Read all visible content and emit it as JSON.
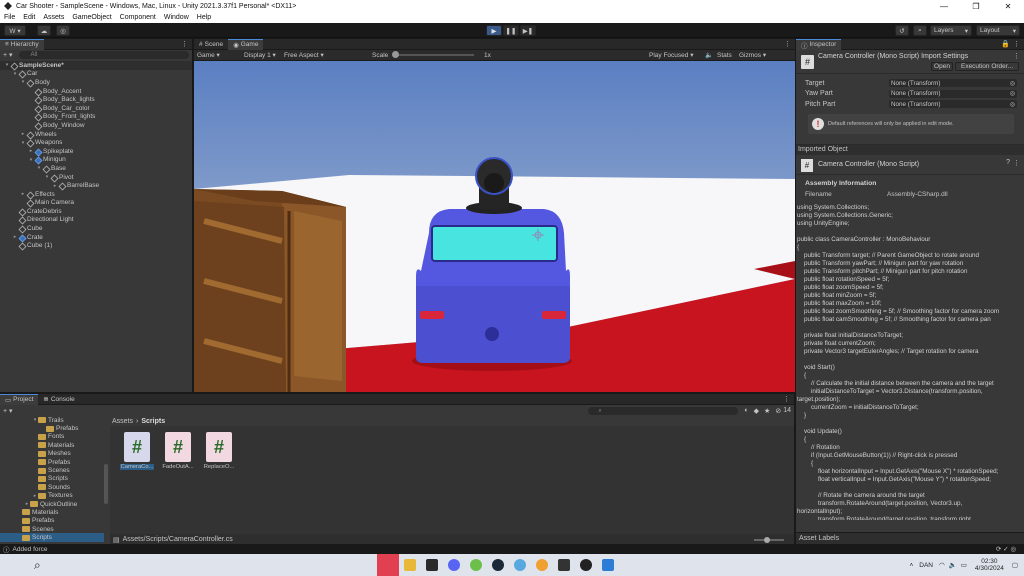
{
  "window": {
    "title": "Car Shooter - SampleScene - Windows, Mac, Linux - Unity 2021.3.37f1 Personal* <DX11>",
    "controls": [
      "—",
      "❐",
      "✕"
    ]
  },
  "menu": [
    "File",
    "Edit",
    "Assets",
    "GameObject",
    "Component",
    "Window",
    "Help"
  ],
  "toolbar": {
    "account": "W ▾",
    "layers": "Layers",
    "layout": "Layout"
  },
  "hierarchy": {
    "tab": "Hierarchy",
    "search_placeholder": "All",
    "items": [
      {
        "label": "SampleScene*",
        "depth": 0,
        "arrow": "▾",
        "type": "scene"
      },
      {
        "label": "Car",
        "depth": 1,
        "arrow": "▾",
        "type": "cube"
      },
      {
        "label": "Body",
        "depth": 2,
        "arrow": "▾",
        "type": "cube"
      },
      {
        "label": "Body_Accent",
        "depth": 3,
        "arrow": "",
        "type": "cube"
      },
      {
        "label": "Body_Back_lights",
        "depth": 3,
        "arrow": "",
        "type": "cube"
      },
      {
        "label": "Body_Car_color",
        "depth": 3,
        "arrow": "",
        "type": "cube"
      },
      {
        "label": "Body_Front_lights",
        "depth": 3,
        "arrow": "",
        "type": "cube"
      },
      {
        "label": "Body_Window",
        "depth": 3,
        "arrow": "",
        "type": "cube"
      },
      {
        "label": "Wheels",
        "depth": 2,
        "arrow": "▸",
        "type": "cube"
      },
      {
        "label": "Weapons",
        "depth": 2,
        "arrow": "▾",
        "type": "cube"
      },
      {
        "label": "Spikeplate",
        "depth": 3,
        "arrow": "▸",
        "type": "blue"
      },
      {
        "label": "Minigun",
        "depth": 3,
        "arrow": "▾",
        "type": "blue"
      },
      {
        "label": "Base",
        "depth": 4,
        "arrow": "▾",
        "type": "cube"
      },
      {
        "label": "Pivot",
        "depth": 5,
        "arrow": "▾",
        "type": "cube"
      },
      {
        "label": "BarrelBase",
        "depth": 6,
        "arrow": "▸",
        "type": "cube"
      },
      {
        "label": "Effects",
        "depth": 2,
        "arrow": "▸",
        "type": "cube"
      },
      {
        "label": "Main Camera",
        "depth": 2,
        "arrow": "",
        "type": "cube"
      },
      {
        "label": "CrateDebris",
        "depth": 1,
        "arrow": "",
        "type": "cube"
      },
      {
        "label": "Directional Light",
        "depth": 1,
        "arrow": "",
        "type": "cube"
      },
      {
        "label": "Cube",
        "depth": 1,
        "arrow": "",
        "type": "cube"
      },
      {
        "label": "Crate",
        "depth": 1,
        "arrow": "▸",
        "type": "blue"
      },
      {
        "label": "Cube (1)",
        "depth": 1,
        "arrow": "",
        "type": "cube"
      }
    ]
  },
  "game_view": {
    "tabs": [
      "Scene",
      "Game"
    ],
    "active_tab": "Game",
    "display_mode": "Game",
    "display": "Display 1",
    "aspect": "Free Aspect",
    "scale_label": "Scale",
    "scale_value": "1x",
    "play_mode": "Play Focused",
    "stats": "Stats",
    "gizmos": "Gizmos"
  },
  "inspector": {
    "tab": "Inspector",
    "component_title": "Camera Controller (Mono Script) Import Settings",
    "open_button": "Open",
    "execution_order_button": "Execution Order...",
    "fields": [
      {
        "label": "Target",
        "value": "None (Transform)"
      },
      {
        "label": "Yaw Part",
        "value": "None (Transform)"
      },
      {
        "label": "Pitch Part",
        "value": "None (Transform)"
      }
    ],
    "warning": "Default references will only be applied in edit mode.",
    "imported_object": "Imported Object",
    "script_title": "Camera Controller (Mono Script)",
    "assembly_info": "Assembly Information",
    "filename_label": "Filename",
    "filename_value": "Assembly-CSharp.dll",
    "asset_labels": "Asset Labels",
    "code": [
      "using System.Collections;",
      "using System.Collections.Generic;",
      "using UnityEngine;",
      "",
      "public class CameraController : MonoBehaviour",
      "{",
      "    public Transform target; // Parent GameObject to rotate around",
      "    public Transform yawPart; // Minigun part for yaw rotation",
      "    public Transform pitchPart; // Minigun part for pitch rotation",
      "    public float rotationSpeed = 5f;",
      "    public float zoomSpeed = 5f;",
      "    public float minZoom = 5f;",
      "    public float maxZoom = 10f;",
      "    public float zoomSmoothing = 5f; // Smoothing factor for camera zoom",
      "    public float camSmoothing = 5f; // Smoothing factor for camera pan",
      "",
      "    private float initialDistanceToTarget;",
      "    private float currentZoom;",
      "    private Vector3 targetEulerAngles; // Target rotation for camera",
      "",
      "    void Start()",
      "    {",
      "        // Calculate the initial distance between the camera and the target",
      "        initialDistanceToTarget = Vector3.Distance(transform.position,",
      "target.position);",
      "        currentZoom = initialDistanceToTarget;",
      "    }",
      "",
      "    void Update()",
      "    {",
      "        // Rotation",
      "        if (Input.GetMouseButton(1)) // Right-click is pressed",
      "        {",
      "            float horizontalInput = Input.GetAxis(\"Mouse X\") * rotationSpeed;",
      "            float verticalInput = Input.GetAxis(\"Mouse Y\") * rotationSpeed;",
      "",
      "            // Rotate the camera around the target",
      "            transform.RotateAround(target.position, Vector3.up,",
      "horizontalInput);",
      "            transform.RotateAround(target.position, transform.right,"
    ]
  },
  "project": {
    "tabs": [
      "Project",
      "Console"
    ],
    "active_tab": "Project",
    "breadcrumb_root": "Assets",
    "breadcrumb_current": "Scripts",
    "search_placeholder": "",
    "hidden_count": "14",
    "path": "Assets/Scripts/CameraController.cs",
    "tree": [
      {
        "label": "Trails",
        "depth": 0,
        "arrow": "▾"
      },
      {
        "label": "Prefabs",
        "depth": 1,
        "arrow": ""
      },
      {
        "label": "Fonts",
        "depth": 0,
        "arrow": ""
      },
      {
        "label": "Materials",
        "depth": 0,
        "arrow": ""
      },
      {
        "label": "Meshes",
        "depth": 0,
        "arrow": ""
      },
      {
        "label": "Prefabs",
        "depth": 0,
        "arrow": ""
      },
      {
        "label": "Scenes",
        "depth": 0,
        "arrow": ""
      },
      {
        "label": "Scripts",
        "depth": 0,
        "arrow": ""
      },
      {
        "label": "Sounds",
        "depth": 0,
        "arrow": ""
      },
      {
        "label": "Textures",
        "depth": 0,
        "arrow": "▸"
      },
      {
        "label": "QuickOutline",
        "depth": -1,
        "arrow": "▸"
      },
      {
        "label": "Materials",
        "depth": -2,
        "arrow": ""
      },
      {
        "label": "Prefabs",
        "depth": -2,
        "arrow": ""
      },
      {
        "label": "Scenes",
        "depth": -2,
        "arrow": ""
      },
      {
        "label": "Scripts",
        "depth": -2,
        "arrow": "",
        "selected": true
      }
    ],
    "assets": [
      {
        "label": "CameraCo...",
        "selected": true
      },
      {
        "label": "FadeOutA...",
        "selected": false
      },
      {
        "label": "ReplaceO...",
        "selected": false
      }
    ]
  },
  "status": {
    "message": "Added force"
  },
  "taskbar": {
    "language": "DAN",
    "time": "02:30",
    "date": "4/30/2024"
  },
  "colors": {
    "accent": "#4b8ad8",
    "sky_top": "#5a7fc2",
    "sky_bottom": "#b9c4d6",
    "ground_red": "#c8141e",
    "car_blue": "#5458e0",
    "crate": "#7a4a22"
  }
}
